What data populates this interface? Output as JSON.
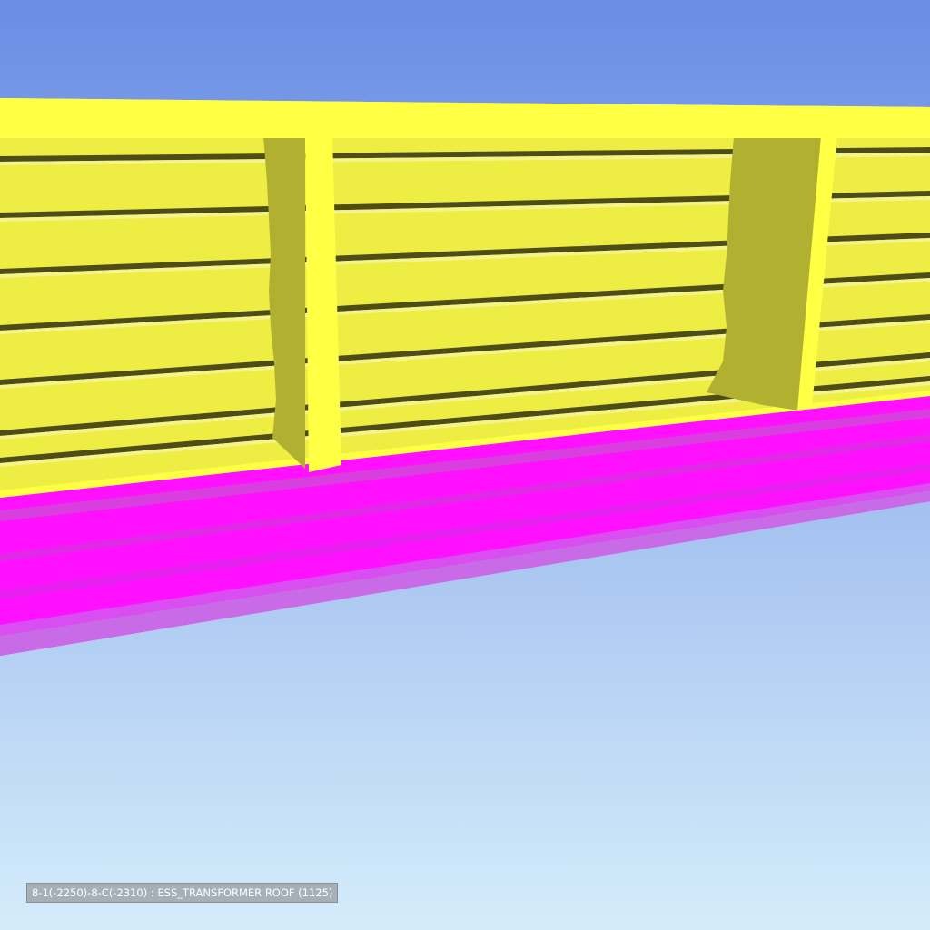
{
  "viewport": {
    "scene": {
      "colors": {
        "sky_top": "#6a8de5",
        "sky_bottom": "#d4ecfa",
        "wall_face": "#ffff44",
        "wall_panel": "#eded44",
        "wall_groove": "#4d4d18",
        "wall_groove_highlight": "#f4f48a",
        "buttress_shadow": "#b2b030",
        "beam_magenta": "#ff10ff",
        "beam_light": "#d94ef0"
      }
    },
    "status_label": {
      "text": "8-1(-2250)-8-C(-2310) : ESS_TRANSFORMER ROOF (1125)"
    }
  }
}
